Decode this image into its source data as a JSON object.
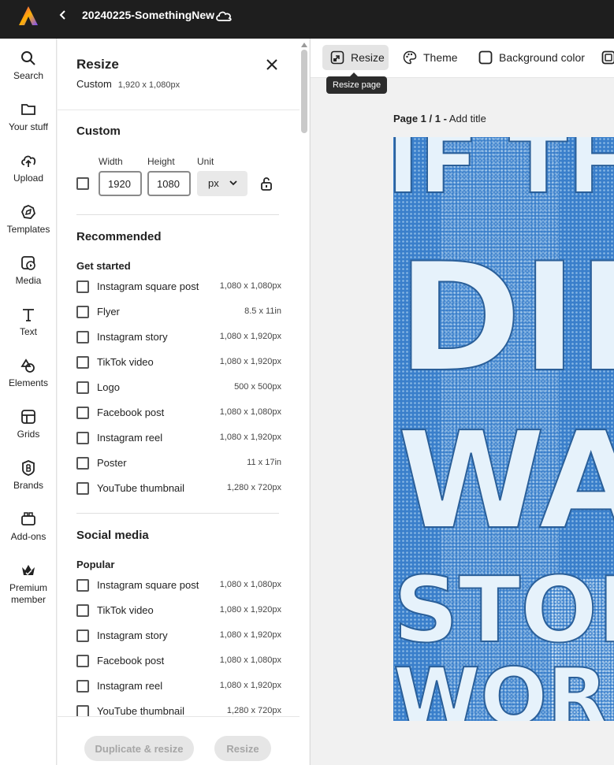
{
  "header": {
    "doc_title": "20240225-SomethingNew"
  },
  "rail": {
    "items": [
      {
        "label": "Search",
        "icon": "search-icon"
      },
      {
        "label": "Your stuff",
        "icon": "folder-icon"
      },
      {
        "label": "Upload",
        "icon": "upload-icon"
      },
      {
        "label": "Templates",
        "icon": "templates-icon"
      },
      {
        "label": "Media",
        "icon": "media-icon"
      },
      {
        "label": "Text",
        "icon": "text-icon"
      },
      {
        "label": "Elements",
        "icon": "elements-icon"
      },
      {
        "label": "Grids",
        "icon": "grid-icon"
      },
      {
        "label": "Brands",
        "icon": "brand-icon"
      },
      {
        "label": "Add-ons",
        "icon": "addons-icon"
      },
      {
        "label": "Premium",
        "label2": "member",
        "icon": "crown-icon"
      }
    ]
  },
  "panel": {
    "title": "Resize",
    "subtitle": "Custom",
    "subtitle_dim": "1,920 x 1,080px",
    "custom": {
      "title": "Custom",
      "width_label": "Width",
      "height_label": "Height",
      "unit_label": "Unit",
      "width_value": "1920",
      "height_value": "1080",
      "unit_value": "px"
    },
    "recommended": {
      "title": "Recommended",
      "subtitle": "Get started",
      "items": [
        {
          "label": "Instagram square post",
          "dim": "1,080 x 1,080px"
        },
        {
          "label": "Flyer",
          "dim": "8.5 x 11in"
        },
        {
          "label": "Instagram story",
          "dim": "1,080 x 1,920px"
        },
        {
          "label": "TikTok video",
          "dim": "1,080 x 1,920px"
        },
        {
          "label": "Logo",
          "dim": "500 x 500px"
        },
        {
          "label": "Facebook post",
          "dim": "1,080 x 1,080px"
        },
        {
          "label": "Instagram reel",
          "dim": "1,080 x 1,920px"
        },
        {
          "label": "Poster",
          "dim": "11 x 17in"
        },
        {
          "label": "YouTube thumbnail",
          "dim": "1,280 x 720px"
        }
      ]
    },
    "social": {
      "title": "Social media",
      "subtitle": "Popular",
      "items": [
        {
          "label": "Instagram square post",
          "dim": "1,080 x 1,080px"
        },
        {
          "label": "TikTok video",
          "dim": "1,080 x 1,920px"
        },
        {
          "label": "Instagram story",
          "dim": "1,080 x 1,920px"
        },
        {
          "label": "Facebook post",
          "dim": "1,080 x 1,080px"
        },
        {
          "label": "Instagram reel",
          "dim": "1,080 x 1,920px"
        },
        {
          "label": "YouTube thumbnail",
          "dim": "1,280 x 720px"
        }
      ]
    },
    "footer": {
      "duplicate_label": "Duplicate & resize",
      "resize_label": "Resize"
    }
  },
  "toolbar": {
    "resize_label": "Resize",
    "theme_label": "Theme",
    "background_label": "Background color",
    "tooltip": "Resize page"
  },
  "canvas": {
    "page_label": "Page 1 / 1 -",
    "add_title": "Add title",
    "artwork_text": [
      "IF TH",
      "DIE",
      "WA",
      "STOP",
      "WORKI"
    ]
  },
  "colors": {
    "artwork_blue": "#3a7fcb",
    "artwork_letters": "#e6f2fb",
    "topbar": "#1e1e1e"
  }
}
